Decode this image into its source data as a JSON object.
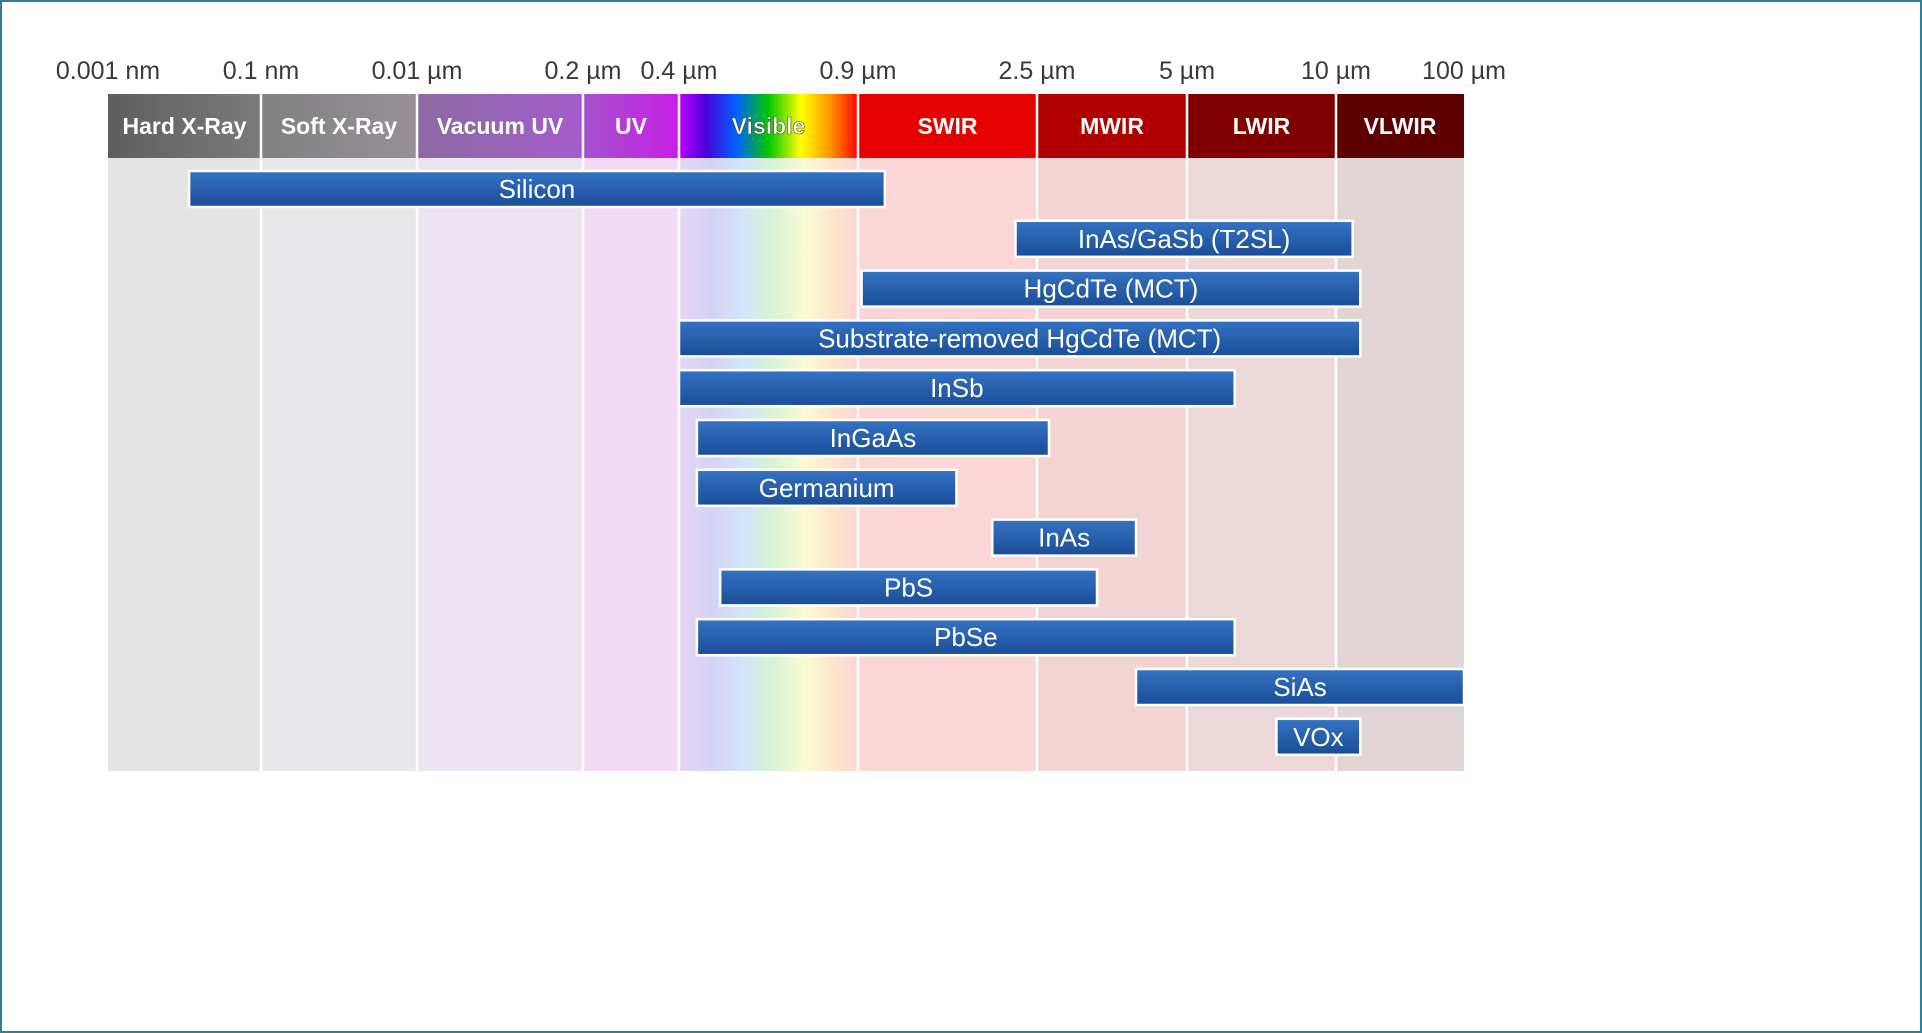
{
  "chart_data": {
    "type": "bar",
    "orientation": "horizontal-range",
    "title": "",
    "xlabel": "",
    "ylabel": "",
    "tick_labels": [
      "0.001 nm",
      "0.1 nm",
      "0.01 µm",
      "0.2 µm",
      "0.4 µm",
      "0.9 µm",
      "2.5 µm",
      "5 µm",
      "10 µm",
      "100 µm"
    ],
    "bands": [
      {
        "name": "Hard X-Ray",
        "from": 0,
        "to": 1,
        "color": "#6a6a6a"
      },
      {
        "name": "Soft X-Ray",
        "from": 1,
        "to": 2,
        "color": "#8d8d8d"
      },
      {
        "name": "Vacuum UV",
        "from": 2,
        "to": 3,
        "color": "#9b5cc0"
      },
      {
        "name": "UV",
        "from": 3,
        "to": 4,
        "color": "#b23fd6"
      },
      {
        "name": "Visible",
        "from": 4,
        "to": 5,
        "color": "spectrum"
      },
      {
        "name": "SWIR",
        "from": 5,
        "to": 6,
        "color": "#e60000"
      },
      {
        "name": "MWIR",
        "from": 6,
        "to": 7,
        "color": "#b00000"
      },
      {
        "name": "LWIR",
        "from": 7,
        "to": 8,
        "color": "#800000"
      },
      {
        "name": "VLWIR",
        "from": 8,
        "to": 9,
        "color": "#5c0000"
      }
    ],
    "bar_color": "#1f57a4",
    "series": [
      {
        "label": "Silicon",
        "start": 0.53,
        "end": 5.15
      },
      {
        "label": "InAs/GaSb (T2SL)",
        "start": 5.88,
        "end": 8.13
      },
      {
        "label": "HgCdTe (MCT)",
        "start": 5.02,
        "end": 8.19
      },
      {
        "label": "Substrate-removed HgCdTe (MCT)",
        "start": 4.0,
        "end": 8.19
      },
      {
        "label": "InSb",
        "start": 4.0,
        "end": 7.32
      },
      {
        "label": "InGaAs",
        "start": 4.1,
        "end": 6.08
      },
      {
        "label": "Germanium",
        "start": 4.1,
        "end": 5.55
      },
      {
        "label": "InAs",
        "start": 5.75,
        "end": 6.66
      },
      {
        "label": "PbS",
        "start": 4.23,
        "end": 6.4
      },
      {
        "label": "PbSe",
        "start": 4.1,
        "end": 7.32
      },
      {
        "label": "SiAs",
        "start": 6.66,
        "end": 9.0
      },
      {
        "label": "VOx",
        "start": 7.6,
        "end": 8.19
      }
    ]
  }
}
